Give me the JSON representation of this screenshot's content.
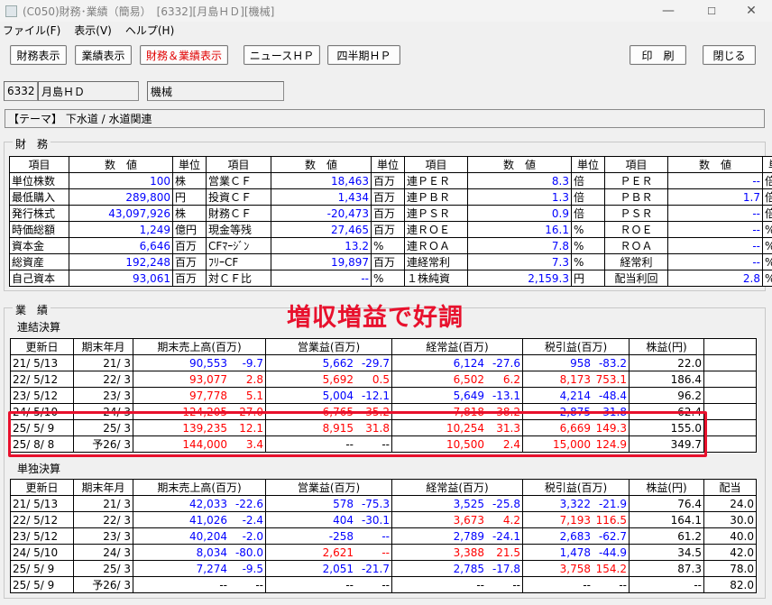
{
  "window": {
    "title": "(C050)財務･業績（簡易）　[6332][月島ＨＤ][機械]",
    "minimize": "—",
    "maximize": "☐",
    "close": "✕"
  },
  "menu": [
    "ファイル(F)",
    "表示(V)",
    "ヘルプ(H)"
  ],
  "toolbar": {
    "financial": "財務表示",
    "results": "業績表示",
    "both": "財務＆業績表示",
    "news": "ニュースＨＰ",
    "quarterly": "四半期ＨＰ",
    "print": "印　刷",
    "close": "閉じる"
  },
  "company": {
    "code": "6332",
    "name": "月島ＨＤ",
    "sector": "機械"
  },
  "theme": "【テーマ】 下水道 / 水道関連",
  "financial": {
    "label": "財　務",
    "headers": [
      "項目",
      "数　値",
      "単位",
      "項目",
      "数　値",
      "単位",
      "項目",
      "数　値",
      "単位",
      "項目",
      "数　値",
      "単位"
    ],
    "rows": [
      [
        "単位株数",
        "100",
        "株",
        "営業ＣＦ",
        "18,463",
        "百万",
        "連ＰＥＲ",
        "8.3",
        "倍",
        "ＰＥＲ",
        "--",
        "倍"
      ],
      [
        "最低購入",
        "289,800",
        "円",
        "投資ＣＦ",
        "1,434",
        "百万",
        "連ＰＢＲ",
        "1.3",
        "倍",
        "ＰＢＲ",
        "1.7",
        "倍"
      ],
      [
        "発行株式",
        "43,097,926",
        "株",
        "財務ＣＦ",
        "-20,473",
        "百万",
        "連ＰＳＲ",
        "0.9",
        "倍",
        "ＰＳＲ",
        "--",
        "倍"
      ],
      [
        "時価総額",
        "1,249",
        "億円",
        "現金等残",
        "27,465",
        "百万",
        "連ＲＯＥ",
        "16.1",
        "%",
        "ＲＯＥ",
        "--",
        "%"
      ],
      [
        "資本金",
        "6,646",
        "百万",
        "CFﾏｰｼﾞﾝ",
        "13.2",
        "%",
        "連ＲＯＡ",
        "7.8",
        "%",
        "ＲＯＡ",
        "--",
        "%"
      ],
      [
        "総資産",
        "192,248",
        "百万",
        "ﾌﾘｰCF",
        "19,897",
        "百万",
        "連経常利",
        "7.3",
        "%",
        "経常利",
        "--",
        "%"
      ],
      [
        "自己資本",
        "93,061",
        "百万",
        "対ＣＦ比",
        "--",
        "%",
        "１株純資",
        "2,159.3",
        "円",
        "配当利回",
        "2.8",
        "%"
      ]
    ]
  },
  "results": {
    "label": "業　績",
    "headline": "増収増益で好調",
    "consolidated": {
      "label": "連結決算",
      "headers": [
        "更新日",
        "期末年月",
        "期末売上高(百万)",
        "営業益(百万)",
        "経常益(百万)",
        "税引益(百万)",
        "株益(円)",
        ""
      ],
      "rows": [
        {
          "date": "21/ 5/13",
          "period": "21/ 3",
          "sales": "90,553",
          "sales_pct": "-9.7",
          "op": "5,662",
          "op_pct": "-29.7",
          "ord": "6,124",
          "ord_pct": "-27.6",
          "net": "958",
          "net_pct": "-83.2",
          "eps": "22.0",
          "c_sales": "blue",
          "c_op": "blue",
          "c_ord": "blue",
          "c_net": "blue"
        },
        {
          "date": "22/ 5/12",
          "period": "22/ 3",
          "sales": "93,077",
          "sales_pct": "2.8",
          "op": "5,692",
          "op_pct": "0.5",
          "ord": "6,502",
          "ord_pct": "6.2",
          "net": "8,173",
          "net_pct": "753.1",
          "eps": "186.4",
          "c_sales": "red",
          "c_op": "red",
          "c_ord": "red",
          "c_net": "red"
        },
        {
          "date": "23/ 5/12",
          "period": "23/ 3",
          "sales": "97,778",
          "sales_pct": "5.1",
          "op": "5,004",
          "op_pct": "-12.1",
          "ord": "5,649",
          "ord_pct": "-13.1",
          "net": "4,214",
          "net_pct": "-48.4",
          "eps": "96.2",
          "c_sales": "red",
          "c_op": "blue",
          "c_ord": "blue",
          "c_net": "blue"
        },
        {
          "date": "24/ 5/10",
          "period": "24/ 3",
          "sales": "124,205",
          "sales_pct": "27.0",
          "op": "6,765",
          "op_pct": "35.2",
          "ord": "7,818",
          "ord_pct": "38.2",
          "net": "2,875",
          "net_pct": "-31.8",
          "eps": "62.4",
          "c_sales": "red",
          "c_op": "red",
          "c_ord": "red",
          "c_net": "blue"
        },
        {
          "date": "25/ 5/ 9",
          "period": "25/ 3",
          "sales": "139,235",
          "sales_pct": "12.1",
          "op": "8,915",
          "op_pct": "31.8",
          "ord": "10,254",
          "ord_pct": "31.3",
          "net": "6,669",
          "net_pct": "149.3",
          "eps": "155.0",
          "c_sales": "red",
          "c_op": "red",
          "c_ord": "red",
          "c_net": "red"
        },
        {
          "date": "25/ 8/ 8",
          "period": "予26/ 3",
          "sales": "144,000",
          "sales_pct": "3.4",
          "op": "--",
          "op_pct": "--",
          "ord": "10,500",
          "ord_pct": "2.4",
          "net": "15,000",
          "net_pct": "124.9",
          "eps": "349.7",
          "c_sales": "red",
          "c_op": "black",
          "c_ord": "red",
          "c_net": "red"
        }
      ]
    },
    "standalone": {
      "label": "単独決算",
      "headers": [
        "更新日",
        "期末年月",
        "期末売上高(百万)",
        "営業益(百万)",
        "経常益(百万)",
        "税引益(百万)",
        "株益(円)",
        "配当"
      ],
      "rows": [
        {
          "date": "21/ 5/13",
          "period": "21/ 3",
          "sales": "42,033",
          "sales_pct": "-22.6",
          "op": "578",
          "op_pct": "-75.3",
          "ord": "3,525",
          "ord_pct": "-25.8",
          "net": "3,322",
          "net_pct": "-21.9",
          "eps": "76.4",
          "div": "24.0",
          "c_sales": "blue",
          "c_op": "blue",
          "c_ord": "blue",
          "c_net": "blue"
        },
        {
          "date": "22/ 5/12",
          "period": "22/ 3",
          "sales": "41,026",
          "sales_pct": "-2.4",
          "op": "404",
          "op_pct": "-30.1",
          "ord": "3,673",
          "ord_pct": "4.2",
          "net": "7,193",
          "net_pct": "116.5",
          "eps": "164.1",
          "div": "30.0",
          "c_sales": "blue",
          "c_op": "blue",
          "c_ord": "red",
          "c_net": "red"
        },
        {
          "date": "23/ 5/12",
          "period": "23/ 3",
          "sales": "40,204",
          "sales_pct": "-2.0",
          "op": "-258",
          "op_pct": "--",
          "ord": "2,789",
          "ord_pct": "-24.1",
          "net": "2,683",
          "net_pct": "-62.7",
          "eps": "61.2",
          "div": "40.0",
          "c_sales": "blue",
          "c_op": "blue",
          "c_ord": "blue",
          "c_net": "blue"
        },
        {
          "date": "24/ 5/10",
          "period": "24/ 3",
          "sales": "8,034",
          "sales_pct": "-80.0",
          "op": "2,621",
          "op_pct": "--",
          "ord": "3,388",
          "ord_pct": "21.5",
          "net": "1,478",
          "net_pct": "-44.9",
          "eps": "34.5",
          "div": "42.0",
          "c_sales": "blue",
          "c_op": "red",
          "c_ord": "red",
          "c_net": "blue"
        },
        {
          "date": "25/ 5/ 9",
          "period": "25/ 3",
          "sales": "7,274",
          "sales_pct": "-9.5",
          "op": "2,051",
          "op_pct": "-21.7",
          "ord": "2,785",
          "ord_pct": "-17.8",
          "net": "3,758",
          "net_pct": "154.2",
          "eps": "87.3",
          "div": "78.0",
          "c_sales": "blue",
          "c_op": "blue",
          "c_ord": "blue",
          "c_net": "red"
        },
        {
          "date": "25/ 5/ 9",
          "period": "予26/ 3",
          "sales": "--",
          "sales_pct": "--",
          "op": "--",
          "op_pct": "--",
          "ord": "--",
          "ord_pct": "--",
          "net": "--",
          "net_pct": "--",
          "eps": "--",
          "div": "82.0",
          "c_sales": "black",
          "c_op": "black",
          "c_ord": "black",
          "c_net": "black"
        }
      ]
    }
  },
  "colors": {
    "blue": "#0000ff",
    "red": "#ff0000",
    "black": "#000000",
    "accent": "#e8112d"
  },
  "icons": {
    "app": "app-window-icon"
  }
}
